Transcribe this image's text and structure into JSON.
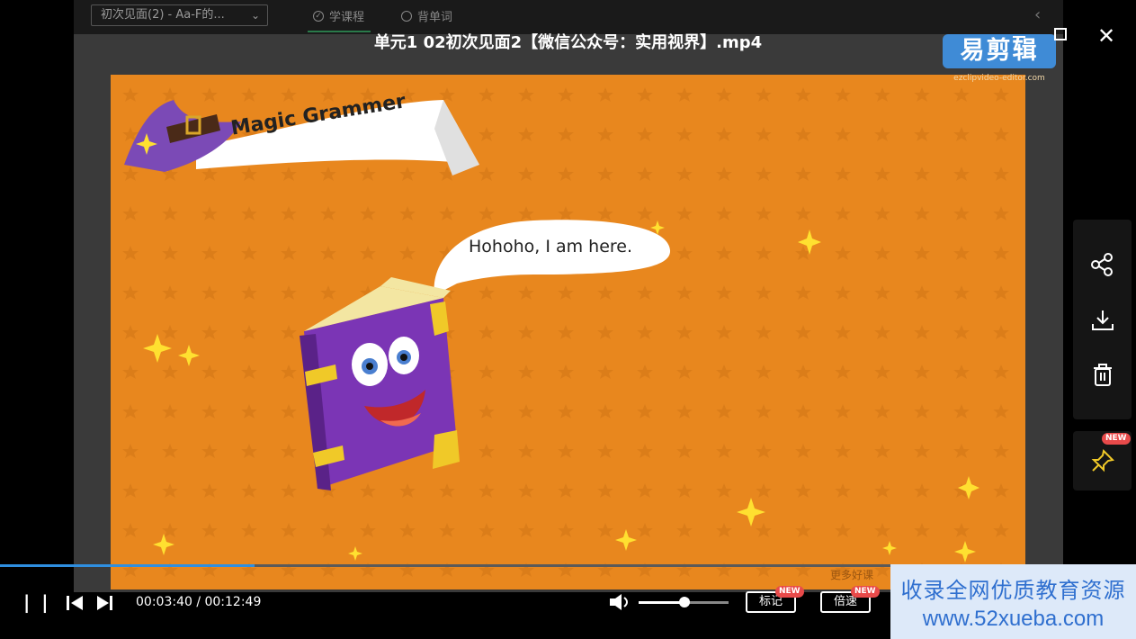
{
  "top_bar": {
    "course_select": "初次见面(2) - Aa-F的...",
    "tab_learn": "学课程",
    "tab_words": "背单词"
  },
  "video_title": "单元1   02初次见面2【微信公众号：实用视界】.mp4",
  "video": {
    "banner_text": "Magic Grammer",
    "speech_bubble": "Hohoho, I am here.",
    "watermark_logo": "易剪辑",
    "watermark_url": "ezclipvideo-editor.com",
    "corner_mark": "更多好课"
  },
  "controls": {
    "current_time": "00:03:40",
    "duration": "00:12:49",
    "time_display": "00:03:40 / 00:12:49",
    "progress_fraction": 0.286,
    "volume_fraction": 0.5,
    "mark_label": "标记",
    "speed_label": "倍速",
    "new_badge": "NEW"
  },
  "side_panel": {
    "icons": [
      "share-icon",
      "download-icon",
      "delete-icon"
    ],
    "pin_badge": "NEW"
  },
  "promo": {
    "line1": "收录全网优质教育资源",
    "line2": "www.52xueba.com"
  },
  "colors": {
    "accent_blue": "#2f8fe0",
    "video_orange": "#e8871e",
    "badge_red": "#e84a4a",
    "promo_text": "#2f6fcf"
  }
}
